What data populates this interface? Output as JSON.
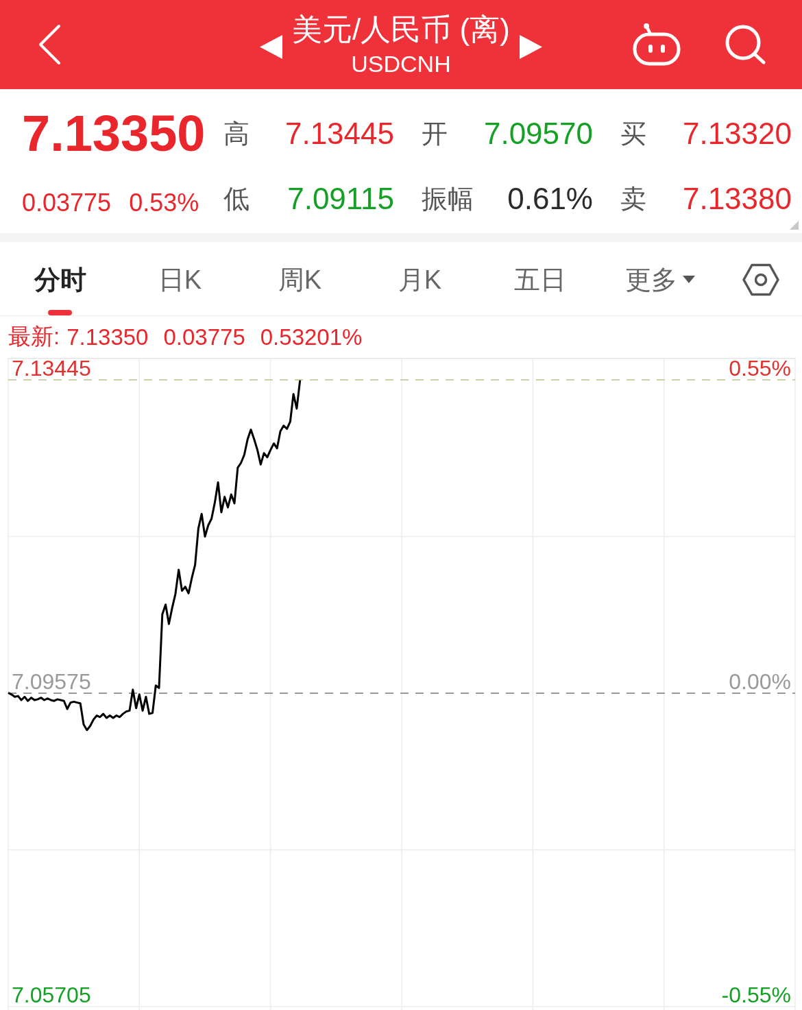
{
  "header": {
    "title": "美元/人民币 (离)",
    "symbol": "USDCNH"
  },
  "quote": {
    "price": "7.13350",
    "color": "#e8262b",
    "change": "0.03775",
    "change_percent": "0.53%",
    "stats": [
      {
        "label": "高",
        "value": "7.13445",
        "color": "#e8262b"
      },
      {
        "label": "开",
        "value": "7.09570",
        "color": "#13a024"
      },
      {
        "label": "买",
        "value": "7.13320",
        "color": "#e8262b"
      },
      {
        "label": "低",
        "value": "7.09115",
        "color": "#13a024"
      },
      {
        "label": "振幅",
        "value": "0.61%",
        "color": "#2b2b2b"
      },
      {
        "label": "卖",
        "value": "7.13380",
        "color": "#e8262b"
      }
    ]
  },
  "tabs": [
    {
      "label": "分时",
      "kind": "tab",
      "selected": true
    },
    {
      "label": "日K",
      "kind": "tab",
      "selected": false
    },
    {
      "label": "周K",
      "kind": "tab",
      "selected": false
    },
    {
      "label": "月K",
      "kind": "tab",
      "selected": false
    },
    {
      "label": "五日",
      "kind": "tab",
      "selected": false
    },
    {
      "label": "更多",
      "kind": "dropdown",
      "selected": false
    }
  ],
  "latest": {
    "label": "最新:",
    "values": [
      "7.13350",
      "0.03775",
      "0.53201%"
    ]
  },
  "chart": {
    "percent_labels": [
      "0.55%",
      "0.00%",
      "-0.55%"
    ],
    "chart_data": {
      "type": "line",
      "categories": [
        null,
        null,
        null,
        null,
        null,
        null,
        null,
        null,
        null,
        null,
        null,
        null,
        null,
        null,
        null,
        null,
        null,
        null,
        null,
        null,
        null,
        null,
        null,
        null,
        null,
        null,
        null,
        null,
        null,
        null,
        null,
        null,
        null,
        null,
        null,
        null,
        null,
        null,
        null,
        null,
        null,
        null,
        null,
        null,
        null,
        null,
        null,
        null,
        null,
        null,
        null,
        null,
        null,
        null,
        null,
        null,
        null,
        null,
        null,
        null,
        null,
        null,
        null,
        null,
        null,
        null,
        null,
        null,
        null,
        null,
        null,
        null,
        null,
        null,
        null,
        null,
        null,
        null,
        null,
        null,
        null,
        null,
        null,
        null,
        null,
        null,
        null,
        null,
        null,
        null,
        null,
        null,
        null,
        null,
        null,
        null,
        null,
        null,
        null,
        null,
        null,
        null,
        null,
        null,
        null,
        null,
        null,
        null,
        null,
        null,
        null,
        null,
        null,
        null,
        null,
        null,
        null,
        null,
        null,
        null,
        null,
        null,
        null,
        null,
        null,
        null,
        null,
        null,
        null,
        null,
        null,
        null,
        null,
        null,
        null,
        null,
        null,
        null,
        null,
        null,
        null,
        null,
        null,
        null,
        null,
        null,
        null,
        null,
        null,
        null,
        null,
        null,
        null,
        null,
        null,
        null,
        null,
        null,
        null,
        null,
        null,
        null,
        null,
        null,
        null,
        null,
        null,
        null,
        null,
        null,
        null,
        null,
        null,
        null,
        null,
        null,
        null,
        null,
        null,
        null,
        null,
        null,
        null,
        null,
        null,
        null,
        null,
        null,
        null,
        null,
        null,
        null,
        null,
        null,
        null,
        null,
        null,
        null,
        null,
        null,
        null,
        null,
        null,
        null,
        null,
        null,
        null,
        null,
        null,
        null,
        null,
        null,
        null,
        null,
        null,
        null,
        null,
        null,
        null,
        null,
        null,
        null,
        null,
        null,
        null,
        null,
        null,
        null,
        null,
        null,
        null,
        null,
        null,
        null,
        null,
        null,
        null,
        null,
        null,
        null,
        null
      ],
      "ylim": [
        7.05705,
        7.13445
      ],
      "yticks": [
        {
          "value": 7.13445,
          "label": "7.13445"
        },
        {
          "value": 7.09575,
          "label": "7.09575"
        },
        {
          "value": 7.05705,
          "label": "7.05705"
        }
      ],
      "ref_lines": [
        {
          "axis": "y",
          "value": 7.13445
        },
        {
          "axis": "y",
          "value": 7.09575
        }
      ],
      "values": [
        7.0958,
        7.0956,
        7.0953,
        7.0954,
        7.0949,
        7.0953,
        7.0948,
        7.0952,
        7.0949,
        7.095,
        7.0952,
        7.0949,
        7.0951,
        7.0949,
        7.0948,
        7.095,
        7.0949,
        7.0948,
        7.0938,
        7.0946,
        7.0947,
        7.0946,
        7.0945,
        7.0919,
        7.0912,
        7.0917,
        7.0925,
        7.093,
        7.0928,
        7.0932,
        7.0927,
        7.093,
        7.0927,
        7.093,
        7.0928,
        7.0932,
        7.0935,
        7.0936,
        7.0962,
        7.0939,
        7.0956,
        7.0936,
        7.0953,
        7.0932,
        7.0933,
        7.0967,
        7.0964,
        7.1055,
        7.1067,
        7.1043,
        7.1063,
        7.108,
        7.111,
        7.1084,
        7.1089,
        7.1081,
        7.11,
        7.1116,
        7.1161,
        7.1179,
        7.1151,
        7.1165,
        7.1173,
        7.1193,
        7.1218,
        7.1181,
        7.12,
        7.1187,
        7.1203,
        7.1192,
        7.1236,
        7.1242,
        7.1252,
        7.1271,
        7.1283,
        7.1271,
        7.1258,
        7.124,
        7.1254,
        7.1249,
        7.1258,
        7.1266,
        7.126,
        7.1281,
        7.1288,
        7.1284,
        7.1293,
        7.1327,
        7.1309,
        7.1344,
        null,
        null,
        null,
        null,
        null,
        null,
        null,
        null,
        null,
        null,
        null,
        null,
        null,
        null,
        null,
        null,
        null,
        null,
        null,
        null,
        null,
        null,
        null,
        null,
        null,
        null,
        null,
        null,
        null,
        null,
        null,
        null,
        null,
        null,
        null,
        null,
        null,
        null,
        null,
        null,
        null,
        null,
        null,
        null,
        null,
        null,
        null,
        null,
        null,
        null,
        null,
        null,
        null,
        null,
        null,
        null,
        null,
        null,
        null,
        null,
        null,
        null,
        null,
        null,
        null,
        null,
        null,
        null,
        null,
        null,
        null,
        null,
        null,
        null,
        null,
        null,
        null,
        null,
        null,
        null,
        null,
        null,
        null,
        null,
        null,
        null,
        null,
        null,
        null,
        null,
        null,
        null,
        null,
        null,
        null,
        null,
        null,
        null,
        null,
        null,
        null,
        null,
        null,
        null,
        null,
        null,
        null,
        null,
        null,
        null,
        null,
        null,
        null,
        null,
        null,
        null,
        null,
        null,
        null,
        null,
        null,
        null,
        null,
        null,
        null,
        null,
        null,
        null,
        null,
        null,
        null,
        null,
        null,
        null,
        null,
        null,
        null,
        null,
        null,
        null,
        null,
        null,
        null,
        null,
        null,
        null,
        null,
        null,
        null,
        null,
        null
      ]
    }
  }
}
